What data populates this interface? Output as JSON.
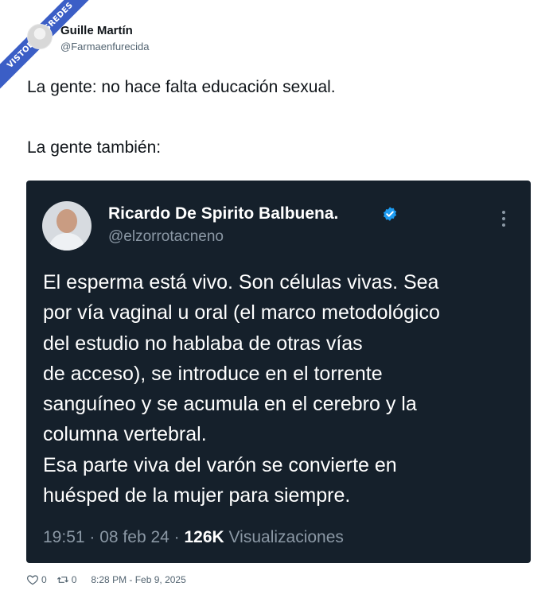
{
  "watermark": {
    "text": "VISTOENLASREDES",
    "color": "#3b5ec6"
  },
  "author": {
    "name": "Guille Martín",
    "handle": "@Farmaenfurecida"
  },
  "tweet": {
    "line1": "La gente: no hace falta educación sexual.",
    "line2": "La gente también:"
  },
  "quoted": {
    "name": "Ricardo De Spirito Balbuena.",
    "handle": "@elzorrotacneno",
    "verified": true,
    "body_lines": [
      "El esperma está vivo. Son células vivas. Sea",
      "por vía vaginal u oral (el marco metodológico",
      "del estudio no hablaba de otras vías",
      "de acceso), se introduce en el torrente",
      "sanguíneo y se acumula en el cerebro y la",
      "columna vertebral.",
      "Esa parte viva del varón se convierte en",
      "huésped de la mujer para siempre."
    ],
    "time": "19:51",
    "separator": "·",
    "date": "08 feb 24",
    "views_count": "126K",
    "views_label": "Visualizaciones",
    "background": "#15202b",
    "verified_color": "#1d9bf0"
  },
  "footer": {
    "likes": "0",
    "retweets": "0",
    "timestamp": "8:28 PM - Feb 9, 2025"
  }
}
